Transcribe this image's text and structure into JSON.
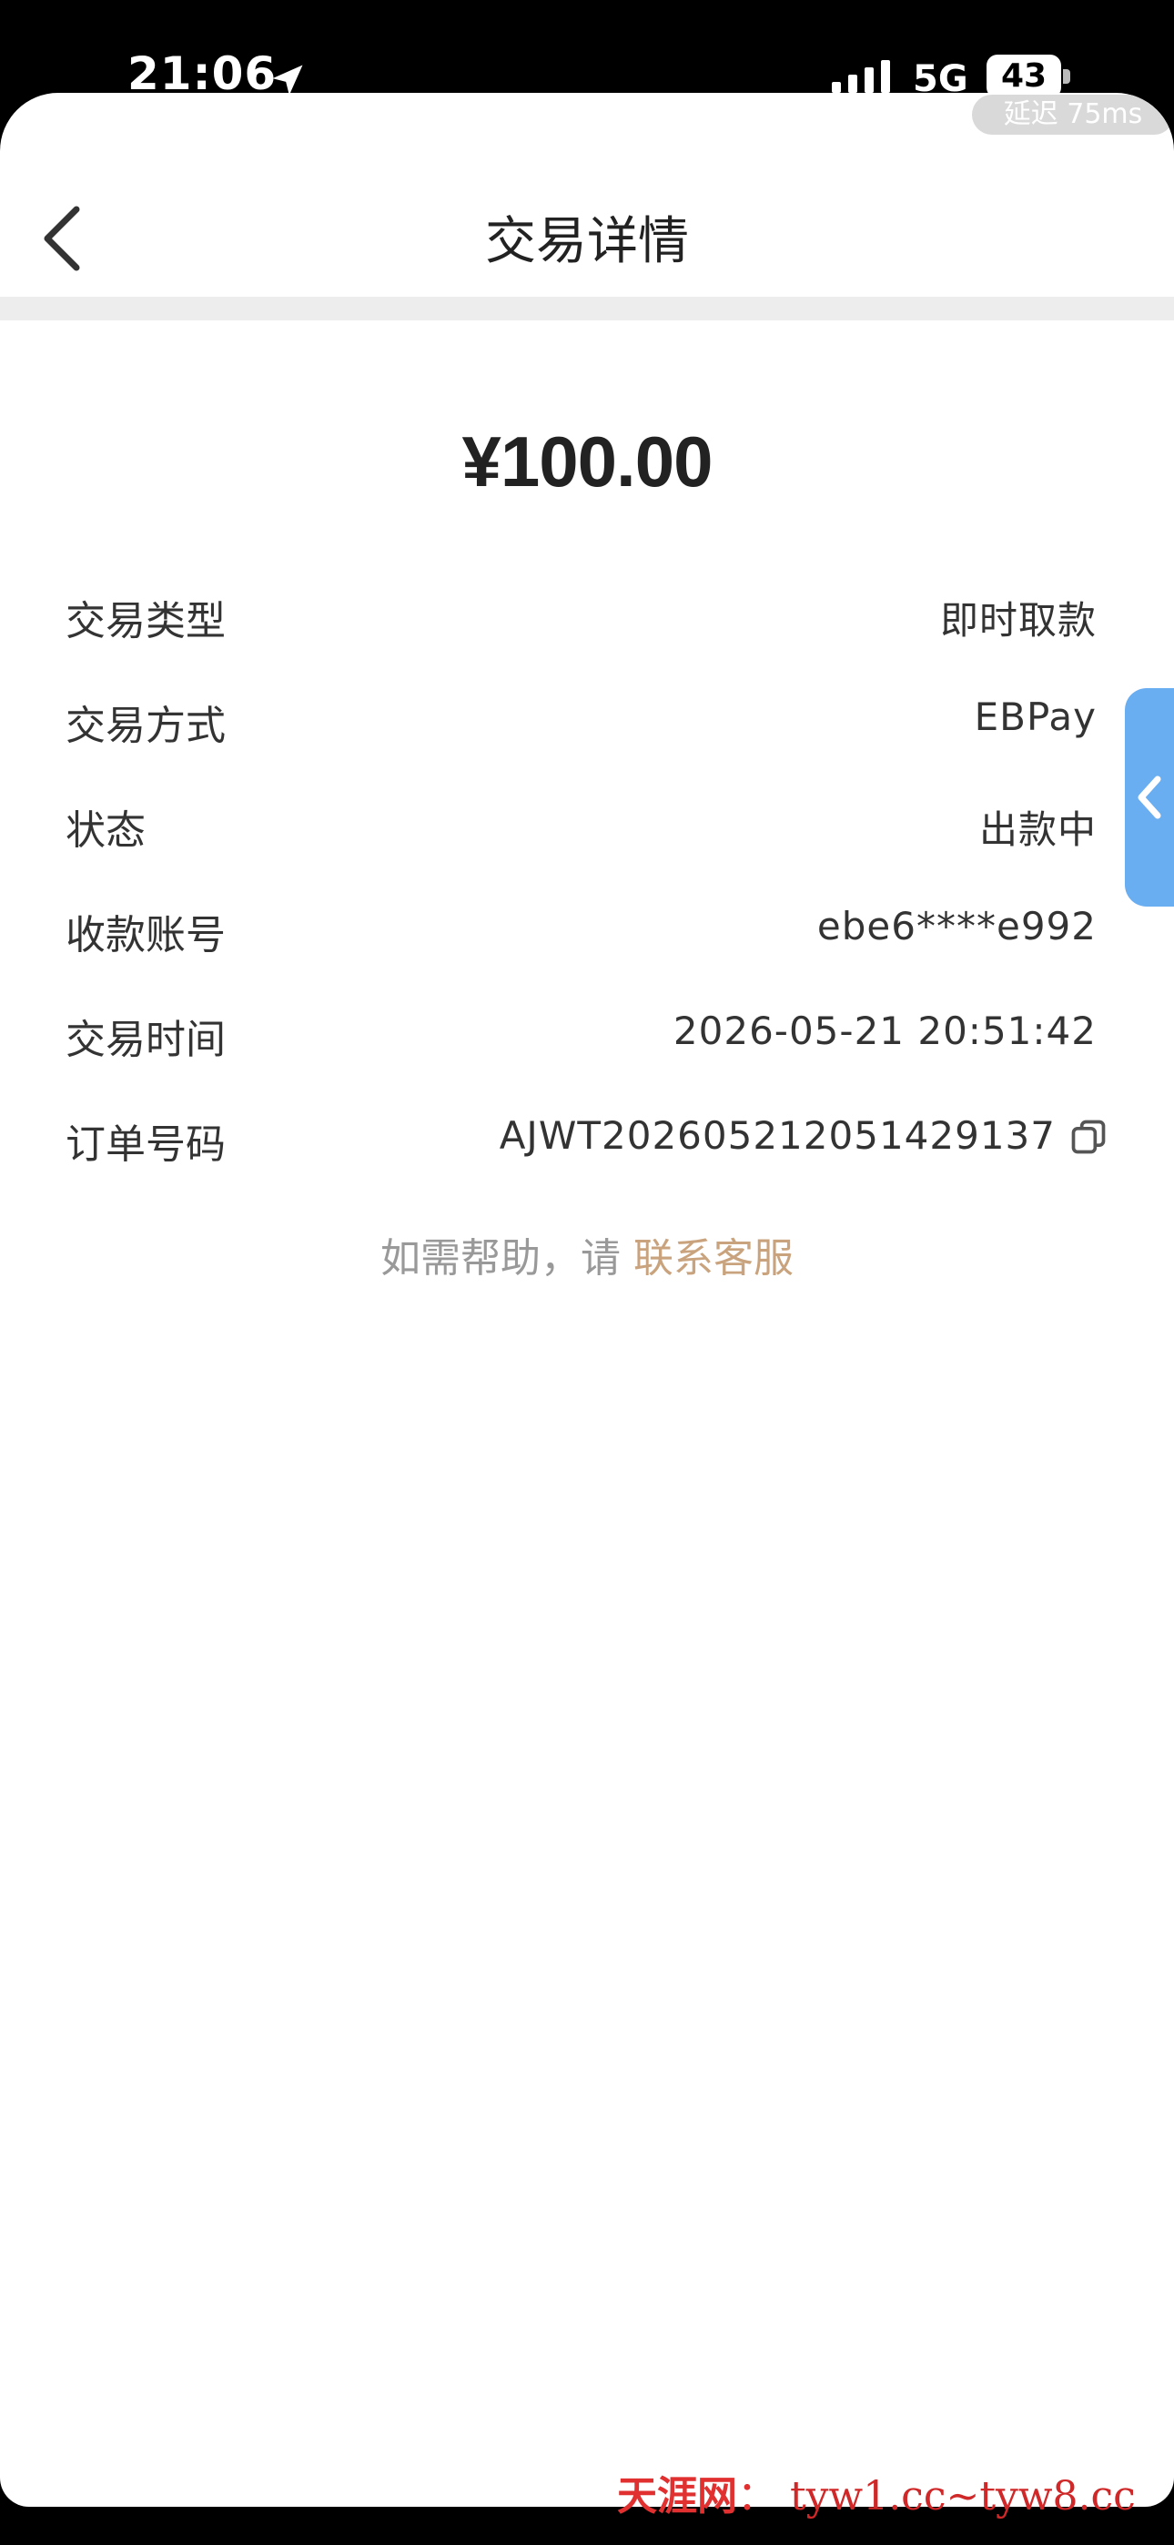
{
  "status_bar": {
    "time": "21:06",
    "network": "5G",
    "battery": "43"
  },
  "latency": "延迟 75ms",
  "header": {
    "title": "交易详情"
  },
  "amount": "¥100.00",
  "details": [
    {
      "label": "交易类型",
      "value": "即时取款"
    },
    {
      "label": "交易方式",
      "value": "EBPay"
    },
    {
      "label": "状态",
      "value": "出款中"
    },
    {
      "label": "收款账号",
      "value": "ebe6****e992"
    },
    {
      "label": "交易时间",
      "value": "2026-05-21 20:51:42"
    },
    {
      "label": "订单号码",
      "value": "AJWT202605212051429137"
    }
  ],
  "help": {
    "prefix": "如需帮助，请",
    "link": "联系客服"
  },
  "watermark": {
    "brand": "天涯网",
    "separator": "：",
    "url": "tyw1.cc~tyw8.cc"
  },
  "colors": {
    "accent_link": "#c9a37d",
    "side_tab": "#6aaef2",
    "watermark": "#e03030"
  },
  "icons": [
    "location-arrow-icon",
    "signal-icon",
    "battery-icon",
    "back-arrow-icon",
    "copy-icon",
    "chevron-left-icon"
  ]
}
